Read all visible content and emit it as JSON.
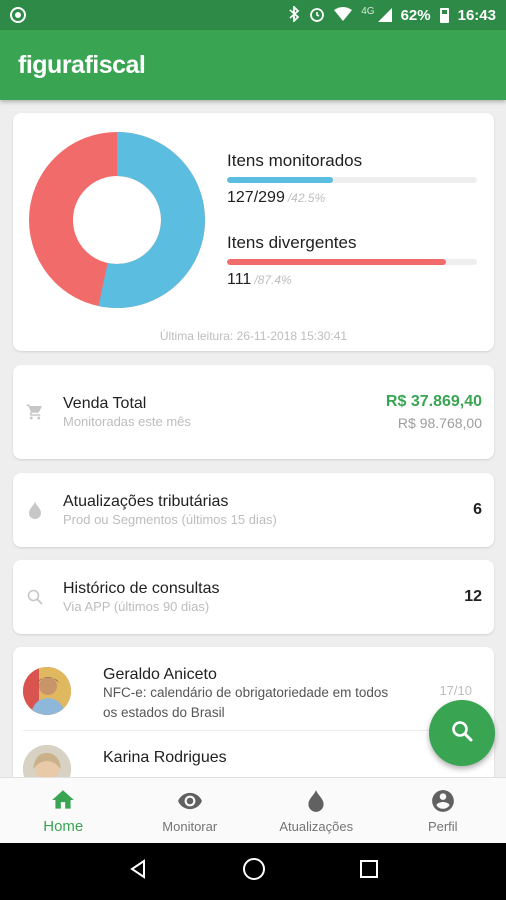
{
  "status_bar": {
    "network": "4G",
    "battery": "62%",
    "time": "16:43"
  },
  "app": {
    "title": "figurafiscal",
    "accent": "#39a553"
  },
  "summary": {
    "monitored_title": "Itens monitorados",
    "monitored_value": "127/299",
    "monitored_pct": "/42.5%",
    "monitored_fraction": 0.425,
    "monitored_color": "#5bbde0",
    "divergent_title": "Itens divergentes",
    "divergent_value": "111",
    "divergent_pct": "/87.4%",
    "divergent_fraction": 0.874,
    "divergent_color": "#f26b6b",
    "last_read": "Última leitura: 26-11-2018 15:30:41"
  },
  "venda": {
    "title": "Venda Total",
    "subtitle": "Monitoradas este mês",
    "value_green": "R$ 37.869,40",
    "value_total": "R$ 98.768,00"
  },
  "atualizacoes": {
    "title": "Atualizações tributárias",
    "subtitle": "Prod ou Segmentos (últimos 15 dias)",
    "count": "6"
  },
  "historico": {
    "title": "Histórico de consultas",
    "subtitle": "Via APP (últimos 90 dias)",
    "count": "12"
  },
  "news": [
    {
      "name": "Geraldo Aniceto",
      "text": "NFC-e: calendário de obrigatoriedade em todos os estados do Brasil",
      "date": "17/10"
    },
    {
      "name": "Karina Rodrigues",
      "text": "",
      "date": ""
    }
  ],
  "bottom_nav": [
    {
      "label": "Home",
      "icon": "home-icon",
      "active": true
    },
    {
      "label": "Monitorar",
      "icon": "eye-icon",
      "active": false
    },
    {
      "label": "Atualizações",
      "icon": "drop-icon",
      "active": false
    },
    {
      "label": "Perfil",
      "icon": "account-icon",
      "active": false
    }
  ]
}
